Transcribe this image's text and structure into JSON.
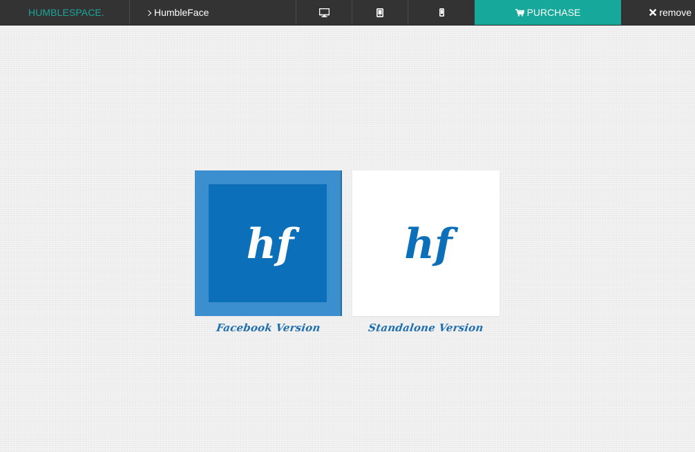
{
  "topbar": {
    "brand": "HUMBLESPACE.",
    "product": "HumbleFace",
    "devices": [
      {
        "icon": "desktop-icon"
      },
      {
        "icon": "tablet-icon"
      },
      {
        "icon": "mobile-icon"
      }
    ],
    "purchase_label": "PURCHASE",
    "purchase_icon": "cart-icon",
    "remove_label": "remove",
    "remove_icon": "close-icon"
  },
  "versions": [
    {
      "logo_text": "hf",
      "caption": "Facebook Version"
    },
    {
      "logo_text": "hf",
      "caption": "Standalone Version"
    }
  ],
  "colors": {
    "topbar": "#333333",
    "brand": "#1aa79b",
    "purchase": "#16a99b",
    "facebook_outer": "#3c8fce",
    "facebook_inner": "#0b6fba",
    "logo_blue": "#1f6fae"
  }
}
